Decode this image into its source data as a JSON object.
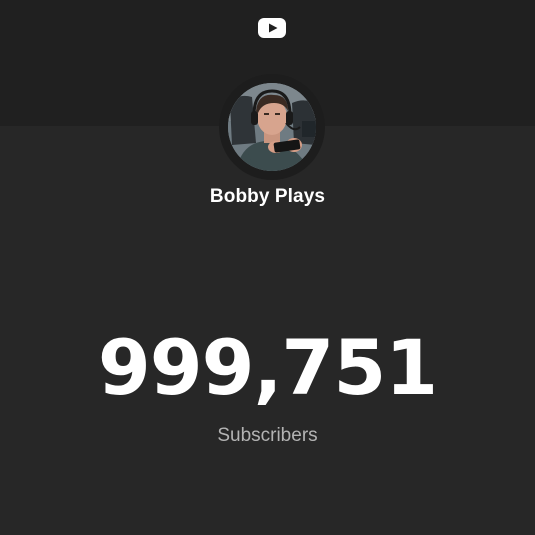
{
  "header": {
    "logo_icon": "youtube-play-icon"
  },
  "channel": {
    "name": "Bobby Plays",
    "avatar": "channel-avatar-photo"
  },
  "stats": {
    "subscriber_count": "999,751",
    "subscriber_label": "Subscribers"
  },
  "colors": {
    "background": "#272727",
    "header_background": "#202020",
    "primary_text": "#ffffff",
    "secondary_text": "#b3b3b3"
  }
}
